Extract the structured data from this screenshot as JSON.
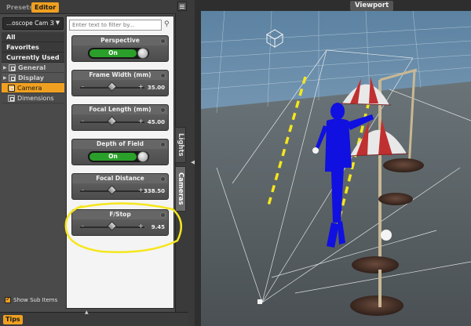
{
  "tabs": {
    "presets": "Presets",
    "editor": "Editor"
  },
  "node_selector": {
    "label": "...oscope Cam 3",
    "arrow": "▼"
  },
  "filter": {
    "placeholder": "Enter text to filter by..."
  },
  "categories": {
    "all": "All",
    "favorites": "Favorites",
    "currently_used": "Currently Used",
    "general": "General",
    "display": "Display",
    "camera": "Camera",
    "dimensions": "Dimensions"
  },
  "show_sub_items": "Show Sub Items",
  "properties": {
    "perspective": {
      "label": "Perspective",
      "state": "On"
    },
    "frame_width": {
      "label": "Frame Width (mm)",
      "value": "35.00",
      "level": 0.5
    },
    "focal_length": {
      "label": "Focal Length (mm)",
      "value": "45.00",
      "level": 0.5
    },
    "depth_of_field": {
      "label": "Depth of Field",
      "state": "On"
    },
    "focal_distance": {
      "label": "Focal Distance",
      "value": "338.50",
      "level": 0.5
    },
    "fstop": {
      "label": "F/Stop",
      "value": "9.45",
      "level": 0.5
    }
  },
  "side_tabs": {
    "lights": "Lights",
    "cameras": "Cameras"
  },
  "bottom": {
    "tips": "Tips"
  },
  "viewport": {
    "title": "Viewport"
  },
  "colors": {
    "accent": "#f0a020",
    "toggle_on": "#2aa02a",
    "annotation": "#f5e61e",
    "figure": "#1010e0",
    "dashed_line": "#f5e61e"
  },
  "icons": [
    "search-icon",
    "panel-menu-icon",
    "expand-triangle-icon",
    "node-box-icon",
    "checkbox-icon",
    "collapse-arrow-icon"
  ]
}
